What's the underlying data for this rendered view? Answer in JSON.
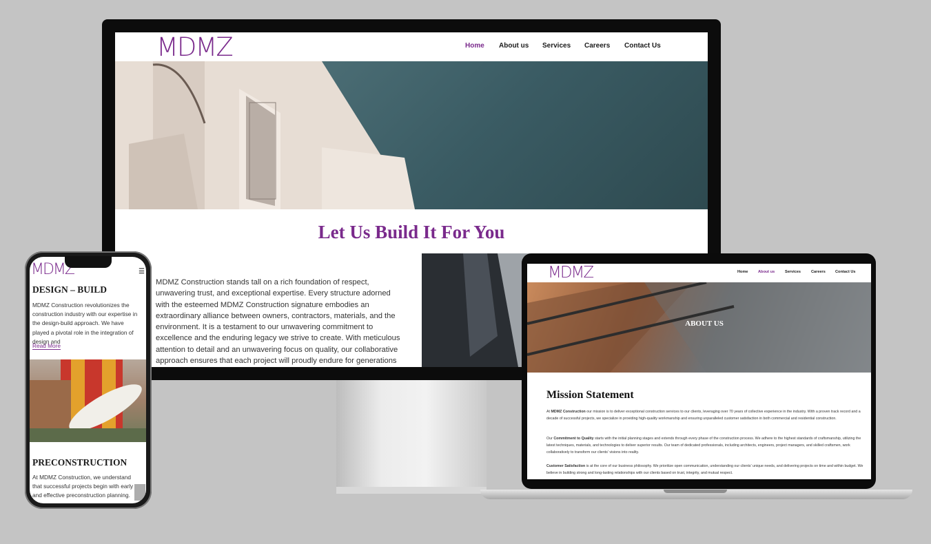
{
  "brand": {
    "logo_text": "MDMZ"
  },
  "desktop": {
    "nav": [
      "Home",
      "About us",
      "Services",
      "Careers",
      "Contact Us"
    ],
    "active": "Home",
    "headline": "Let Us Build It For You",
    "paragraph": "MDMZ Construction stands tall on a rich foundation of respect, unwavering trust, and exceptional expertise. Every structure adorned with the esteemed MDMZ Construction signature embodies an extraordinary alliance between owners, contractors, materials, and the environment. It is a testament to our unwavering commitment to excellence and the enduring legacy we strive to create. With meticulous attention to detail and an unwavering focus on quality, our collaborative approach ensures that each project will proudly endure for generations to come."
  },
  "mobile": {
    "section1_title": "DESIGN – BUILD",
    "section1_text": "MDMZ Construction revolutionizes the construction industry with our expertise in the design-build approach. We have played a pivotal role in the integration of design and",
    "read_more": "Read More",
    "section2_title": "PRECONSTRUCTION",
    "section2_text": "At MDMZ Construction, we understand that successful projects begin with early and effective preconstruction planning. Our"
  },
  "laptop": {
    "nav": [
      "Home",
      "About us",
      "Services",
      "Careers",
      "Contact Us"
    ],
    "active": "About us",
    "hero_title": "ABOUT US",
    "heading": "Mission Statement",
    "p1_lead": "At ",
    "p1_bold": "MDMZ Construction",
    "p1_rest": " our mission is to deliver exceptional construction services to our clients, leveraging over 70 years of collective experience in the industry. With a proven track record and a decade of successful projects, we specialize in providing high-quality workmanship and ensuring unparalleled customer satisfaction in both commercial and residential construction.",
    "p2_lead": "Our ",
    "p2_bold": "Commitment to Quality",
    "p2_rest": " starts with the initial planning stages and extends through every phase of the construction process. We adhere to the highest standards of craftsmanship, utilizing the latest techniques, materials, and technologies to deliver superior results. Our team of dedicated professionals, including architects, engineers, project managers, and skilled craftsmen, work collaboratively to transform our clients' visions into reality.",
    "p3_bold": "Customer Satisfaction",
    "p3_rest": " is at the core of our business philosophy. We prioritize open communication, understanding our clients' unique needs, and delivering projects on time and within budget. We believe in building strong and long-lasting relationships with our clients based on trust, integrity, and mutual respect."
  },
  "colors": {
    "accent": "#7a2a8c",
    "background": "#c4c4c4"
  }
}
